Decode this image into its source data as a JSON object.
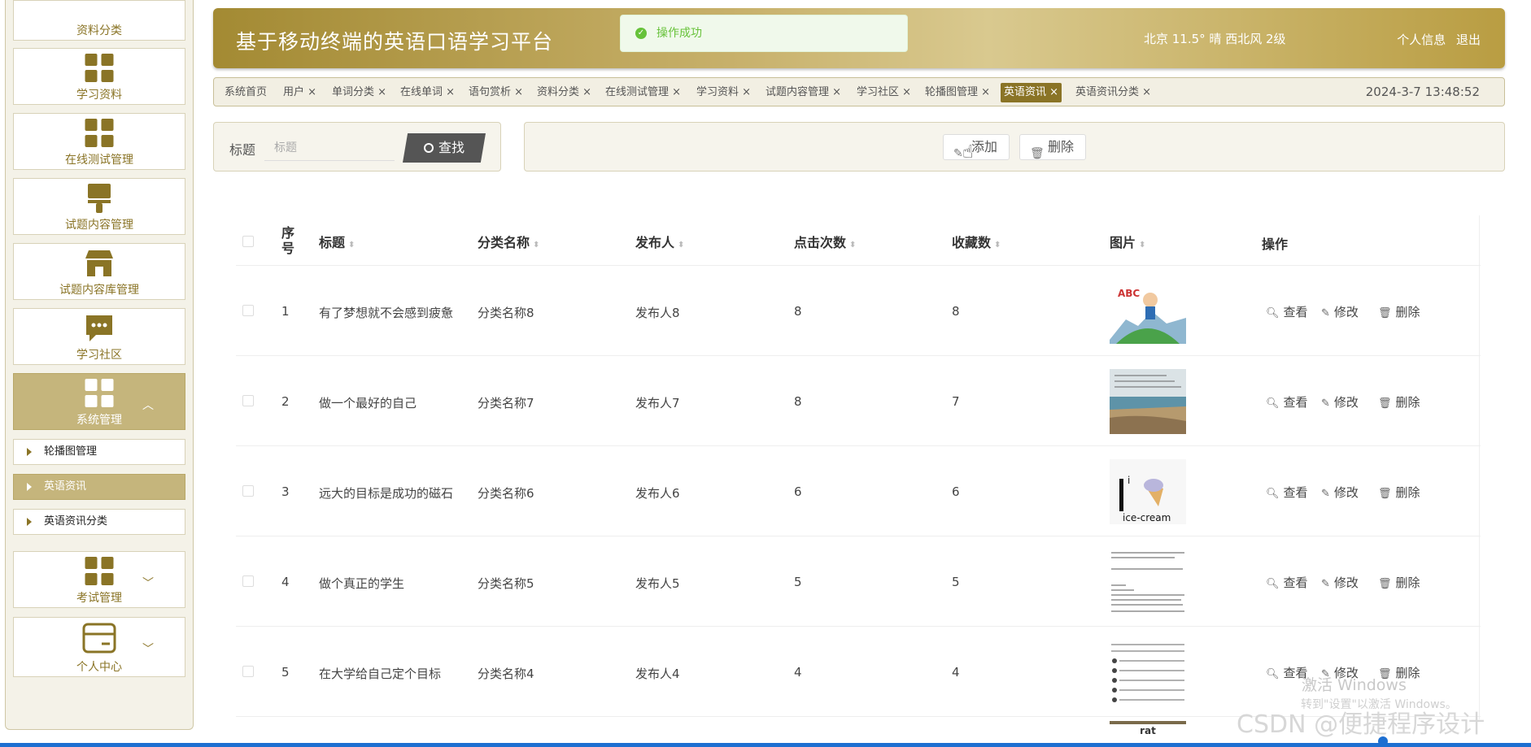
{
  "header": {
    "title": "基于移动终端的英语口语学习平台",
    "weather": "北京  11.5°  晴  西北风  2级",
    "profile_link": "个人信息",
    "logout_link": "退出"
  },
  "toast": {
    "message": "操作成功"
  },
  "sidebar": {
    "menu": [
      {
        "label": "资料分类"
      },
      {
        "label": "学习资料"
      },
      {
        "label": "在线测试管理"
      },
      {
        "label": "试题内容管理"
      },
      {
        "label": "试题内容库管理"
      },
      {
        "label": "学习社区"
      },
      {
        "label": "系统管理",
        "expanded": true
      },
      {
        "label": "考试管理"
      },
      {
        "label": "个人中心"
      }
    ],
    "submenu": [
      {
        "label": "轮播图管理"
      },
      {
        "label": "英语资讯",
        "active": true
      },
      {
        "label": "英语资讯分类"
      }
    ]
  },
  "tags": {
    "items": [
      "系统首页",
      "用户 ×",
      "单词分类 ×",
      "在线单词 ×",
      "语句赏析 ×",
      "资料分类 ×",
      "在线测试管理 ×",
      "学习资料 ×",
      "试题内容管理 ×",
      "学习社区 ×",
      "轮播图管理 ×",
      "英语资讯 ×",
      "英语资讯分类 ×"
    ],
    "active": "英语资讯 ×",
    "datetime": "2024-3-7 13:48:52"
  },
  "search": {
    "label": "标题",
    "placeholder": "标题",
    "button": "查找"
  },
  "actions": {
    "add": "添加",
    "delete": "删除"
  },
  "table": {
    "headers": {
      "index": "序号",
      "title": "标题",
      "category": "分类名称",
      "publisher": "发布人",
      "clicks": "点击次数",
      "favorites": "收藏数",
      "image": "图片",
      "ops": "操作"
    },
    "op_labels": {
      "view": "查看",
      "edit": "修改",
      "delete": "删除"
    },
    "rows": [
      {
        "index": "1",
        "title": "有了梦想就不会感到疲惫",
        "category": "分类名称8",
        "publisher": "发布人8",
        "clicks": "8",
        "favorites": "8",
        "image": "cartoon-abc"
      },
      {
        "index": "2",
        "title": "做一个最好的自己",
        "category": "分类名称7",
        "publisher": "发布人7",
        "clicks": "8",
        "favorites": "7",
        "image": "beach-quote"
      },
      {
        "index": "3",
        "title": "远大的目标是成功的磁石",
        "category": "分类名称6",
        "publisher": "发布人6",
        "clicks": "6",
        "favorites": "6",
        "image": "ice-cream-card"
      },
      {
        "index": "4",
        "title": "做个真正的学生",
        "category": "分类名称5",
        "publisher": "发布人5",
        "clicks": "5",
        "favorites": "5",
        "image": "text-page"
      },
      {
        "index": "5",
        "title": "在大学给自己定个目标",
        "category": "分类名称4",
        "publisher": "发布人4",
        "clicks": "4",
        "favorites": "4",
        "image": "worksheet"
      }
    ],
    "partial_row_image_text": "rat"
  },
  "overlay": {
    "win_activate": "激活 Windows",
    "win_activate_sub": "转到\"设置\"以激活 Windows。",
    "csdn": "CSDN @便捷程序设计"
  },
  "colors": {
    "brand": "#8a7426",
    "brand_light": "#c5b57c",
    "success": "#67c23a"
  }
}
